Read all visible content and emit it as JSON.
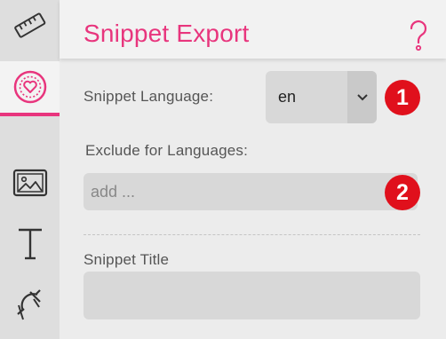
{
  "header": {
    "title": "Snippet Export",
    "help_icon": "question-icon"
  },
  "sidebar": {
    "items": [
      {
        "icon": "ruler-icon",
        "active": false
      },
      {
        "icon": "heart-badge-icon",
        "active": true
      },
      {
        "icon": "image-icon",
        "active": false
      },
      {
        "icon": "text-tool-icon",
        "active": false
      },
      {
        "icon": "magnet-icon",
        "active": false
      }
    ]
  },
  "form": {
    "language_label": "Snippet Language:",
    "language_value": "en",
    "exclude_label": "Exclude for Languages:",
    "exclude_placeholder": "add ...",
    "snippet_title_label": "Snippet Title"
  },
  "badges": [
    "1",
    "2"
  ],
  "colors": {
    "accent": "#e8357d",
    "badge": "#e0101c"
  }
}
